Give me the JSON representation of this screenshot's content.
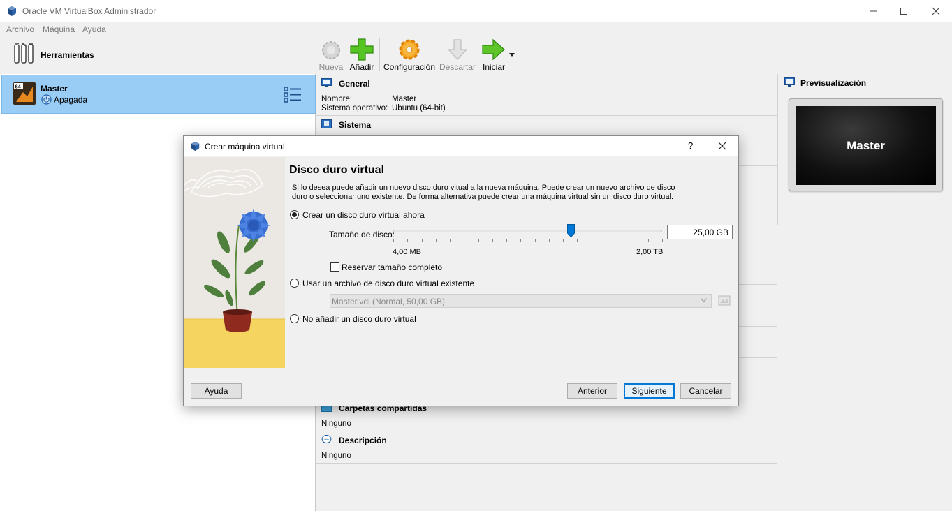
{
  "window": {
    "title": "Oracle VM VirtualBox Administrador",
    "icon": "virtualbox-cube-icon"
  },
  "menu": [
    "Archivo",
    "Máquina",
    "Ayuda"
  ],
  "sidebar": {
    "tools_label": "Herramientas",
    "vm": {
      "name": "Master",
      "state": "Apagada",
      "badge": "64"
    }
  },
  "toolbar": {
    "buttons": [
      {
        "label": "Nueva",
        "enabled": false,
        "icon": "gear-new-icon"
      },
      {
        "label": "Añadir",
        "enabled": true,
        "icon": "plus-icon"
      },
      {
        "label": "Configuración",
        "enabled": true,
        "icon": "gear-icon"
      },
      {
        "label": "Descartar",
        "enabled": false,
        "icon": "arrow-down-icon"
      },
      {
        "label": "Iniciar",
        "enabled": true,
        "icon": "arrow-right-icon"
      }
    ]
  },
  "details": {
    "general": {
      "title": "General",
      "name_label": "Nombre:",
      "name_value": "Master",
      "os_label": "Sistema operativo:",
      "os_value": "Ubuntu (64-bit)"
    },
    "system_title": "Sistema",
    "shared_folders": {
      "title": "Carpetas compartidas",
      "value": "Ninguno"
    },
    "description": {
      "title": "Descripción",
      "value": "Ninguno"
    }
  },
  "preview": {
    "title": "Previsualización",
    "screen_text": "Master"
  },
  "dialog": {
    "title": "Crear máquina virtual",
    "help_glyph": "?",
    "heading": "Disco duro virtual",
    "paragraph": "Si lo desea puede añadir un nuevo disco duro vitual a la nueva máquina. Puede crear un nuevo archivo de disco duro o seleccionar uno existente. De forma alternativa puede crear una máquina virtual sin un disco duro virtual.",
    "options": {
      "create_now": "Crear un disco duro virtual ahora",
      "use_existing": "Usar un archivo de disco duro virtual existente",
      "no_disk": "No añadir un disco duro virtual"
    },
    "selected_option": "create_now",
    "disk_size_label": "Tamaño de disco:",
    "disk_size_value": "25,00 GB",
    "slider_min_label": "4,00 MB",
    "slider_max_label": "2,00 TB",
    "slider_fraction": 0.66,
    "reserve_full_label": "Reservar tamaño completo",
    "reserve_full_checked": false,
    "existing_disk_value": "Master.vdi (Normal, 50,00 GB)",
    "buttons": {
      "help": "Ayuda",
      "back": "Anterior",
      "next": "Siguiente",
      "cancel": "Cancelar"
    }
  },
  "colors": {
    "selection": "#99cdf5",
    "accent": "#0078d7",
    "panel": "#f0f0f0"
  }
}
